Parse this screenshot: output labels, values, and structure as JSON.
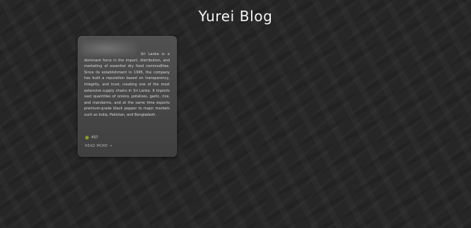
{
  "header": {
    "title": "Yurei Blog"
  },
  "post": {
    "body": "Sri Lanka is a dominant force in the import, distribution, and marketing of essential dry food commodities. Since its establishment in 1995, the company has built a reputation based on transparency, integrity, and trust, creating one of the most extensive supply chains in Sri Lanka. It imports vast quantities of onions, potatoes, garlic, rice, and mandarins, and at the same time exports premium-grade black pepper to major markets such as India, Pakistan, and Bangladesh.",
    "views": "437",
    "read_more_label": "READ MORE",
    "read_more_arrow": "→",
    "icon": "eye-icon",
    "accent_color": "#8a9a2a"
  }
}
